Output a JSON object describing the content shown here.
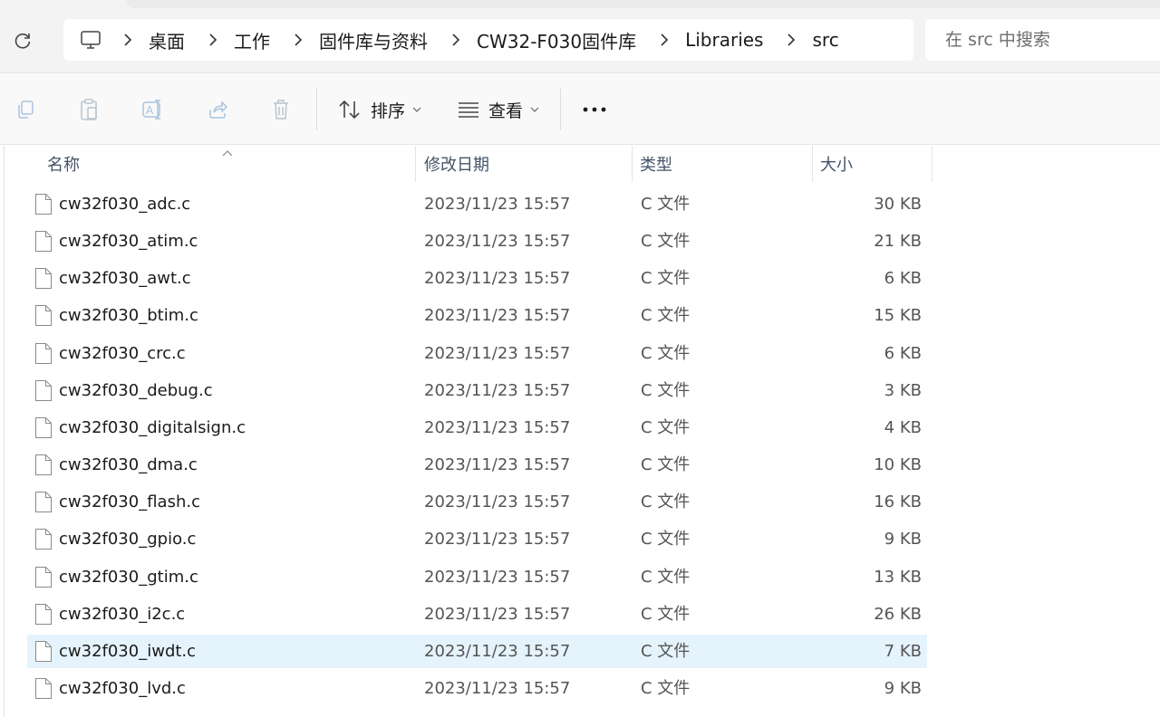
{
  "breadcrumb": {
    "items": [
      "桌面",
      "工作",
      "固件库与资料",
      "CW32-F030固件库",
      "Libraries",
      "src"
    ]
  },
  "search": {
    "placeholder": "在 src 中搜索"
  },
  "command_bar": {
    "sort_label": "排序",
    "view_label": "查看"
  },
  "columns": {
    "name": "名称",
    "date": "修改日期",
    "type": "类型",
    "size": "大小"
  },
  "files": [
    {
      "name": "cw32f030_adc.c",
      "date": "2023/11/23 15:57",
      "type": "C 文件",
      "size": "30 KB"
    },
    {
      "name": "cw32f030_atim.c",
      "date": "2023/11/23 15:57",
      "type": "C 文件",
      "size": "21 KB"
    },
    {
      "name": "cw32f030_awt.c",
      "date": "2023/11/23 15:57",
      "type": "C 文件",
      "size": "6 KB"
    },
    {
      "name": "cw32f030_btim.c",
      "date": "2023/11/23 15:57",
      "type": "C 文件",
      "size": "15 KB"
    },
    {
      "name": "cw32f030_crc.c",
      "date": "2023/11/23 15:57",
      "type": "C 文件",
      "size": "6 KB"
    },
    {
      "name": "cw32f030_debug.c",
      "date": "2023/11/23 15:57",
      "type": "C 文件",
      "size": "3 KB"
    },
    {
      "name": "cw32f030_digitalsign.c",
      "date": "2023/11/23 15:57",
      "type": "C 文件",
      "size": "4 KB"
    },
    {
      "name": "cw32f030_dma.c",
      "date": "2023/11/23 15:57",
      "type": "C 文件",
      "size": "10 KB"
    },
    {
      "name": "cw32f030_flash.c",
      "date": "2023/11/23 15:57",
      "type": "C 文件",
      "size": "16 KB"
    },
    {
      "name": "cw32f030_gpio.c",
      "date": "2023/11/23 15:57",
      "type": "C 文件",
      "size": "9 KB"
    },
    {
      "name": "cw32f030_gtim.c",
      "date": "2023/11/23 15:57",
      "type": "C 文件",
      "size": "13 KB"
    },
    {
      "name": "cw32f030_i2c.c",
      "date": "2023/11/23 15:57",
      "type": "C 文件",
      "size": "26 KB"
    },
    {
      "name": "cw32f030_iwdt.c",
      "date": "2023/11/23 15:57",
      "type": "C 文件",
      "size": "7 KB",
      "selected": true
    },
    {
      "name": "cw32f030_lvd.c",
      "date": "2023/11/23 15:57",
      "type": "C 文件",
      "size": "9 KB"
    }
  ],
  "colors": {
    "selection": "#e5f3fd",
    "icon_gray": "#b0b7bf"
  }
}
